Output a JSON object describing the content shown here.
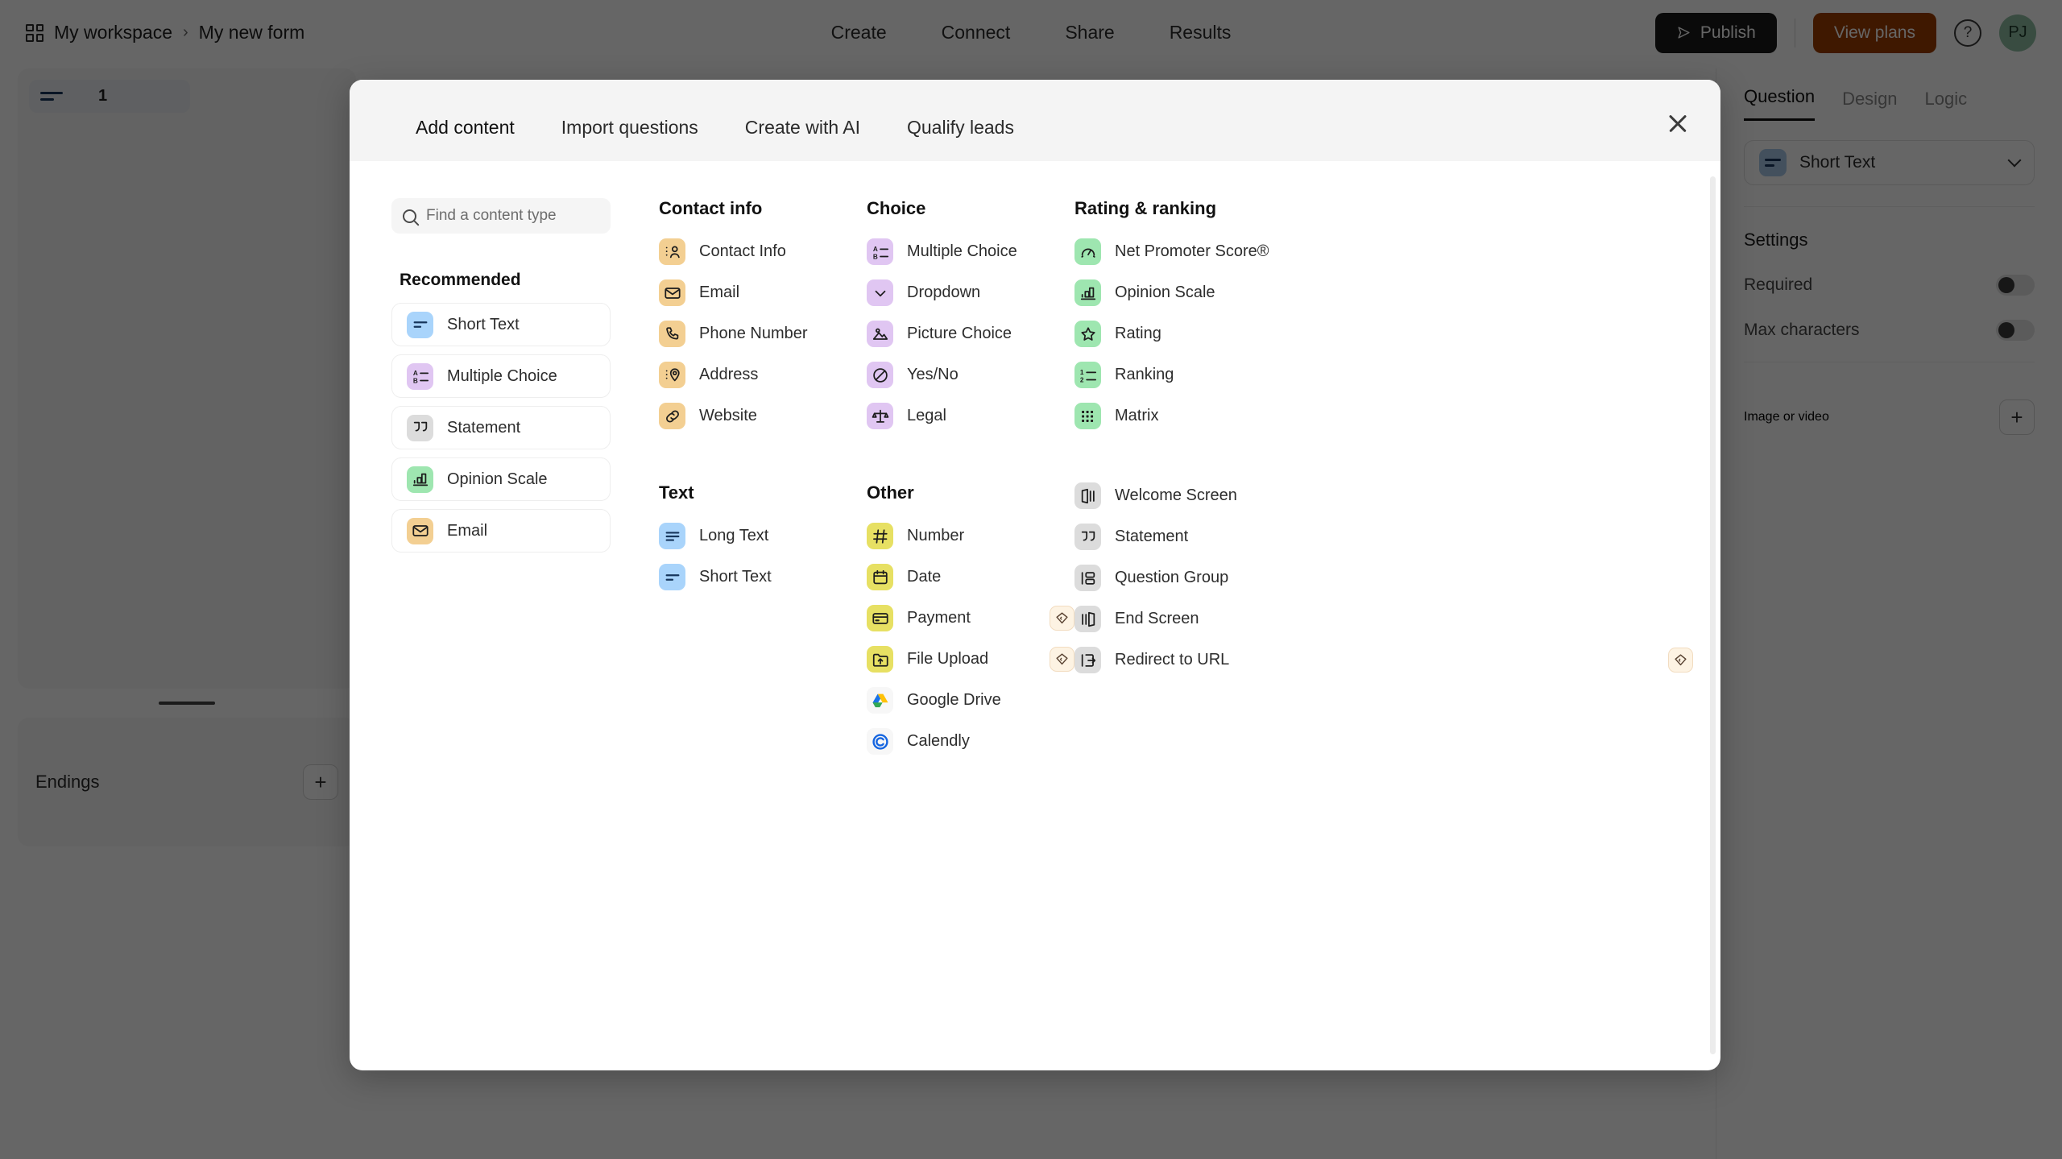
{
  "topbar": {
    "workspace": "My workspace",
    "separator": "›",
    "form_name": "My new form",
    "nav": [
      "Create",
      "Connect",
      "Share",
      "Results"
    ],
    "publish_label": "Publish",
    "view_plans_label": "View plans",
    "help_label": "?",
    "avatar_initials": "PJ"
  },
  "left_panel": {
    "question_number": "1",
    "endings_label": "Endings",
    "add_ending_label": "+"
  },
  "right_panel": {
    "tabs": [
      "Question",
      "Design",
      "Logic"
    ],
    "active_tab": "Question",
    "type_selector": "Short Text",
    "settings_heading": "Settings",
    "rows": [
      {
        "label": "Required",
        "value": "off"
      },
      {
        "label": "Max characters",
        "value": "off"
      }
    ],
    "image_or_video_label": "Image or video",
    "add_media_label": "+"
  },
  "modal": {
    "tabs": [
      {
        "label": "Add content",
        "active": true
      },
      {
        "label": "Import questions",
        "active": false
      },
      {
        "label": "Create with AI",
        "active": false
      },
      {
        "label": "Qualify leads",
        "active": false
      }
    ],
    "close_label": "×",
    "search": {
      "placeholder": "Find a content type",
      "value": ""
    },
    "recommended": {
      "title": "Recommended",
      "items": [
        {
          "label": "Short Text",
          "icon": "short-text-icon",
          "color": "blue"
        },
        {
          "label": "Multiple Choice",
          "icon": "multiple-choice-icon",
          "color": "purple"
        },
        {
          "label": "Statement",
          "icon": "statement-icon",
          "color": "gray"
        },
        {
          "label": "Opinion Scale",
          "icon": "opinion-scale-icon",
          "color": "green"
        },
        {
          "label": "Email",
          "icon": "email-icon",
          "color": "orange"
        }
      ]
    },
    "categories": [
      {
        "name": "Contact info",
        "column": 1,
        "items": [
          {
            "label": "Contact Info",
            "icon": "contact-info-icon",
            "color": "orange",
            "premium": false
          },
          {
            "label": "Email",
            "icon": "email-icon",
            "color": "orange",
            "premium": false
          },
          {
            "label": "Phone Number",
            "icon": "phone-icon",
            "color": "orange",
            "premium": false
          },
          {
            "label": "Address",
            "icon": "address-icon",
            "color": "orange",
            "premium": false
          },
          {
            "label": "Website",
            "icon": "website-link-icon",
            "color": "orange",
            "premium": false
          }
        ]
      },
      {
        "name": "Text",
        "column": 1,
        "items": [
          {
            "label": "Long Text",
            "icon": "long-text-icon",
            "color": "blue",
            "premium": false
          },
          {
            "label": "Short Text",
            "icon": "short-text-icon",
            "color": "blue",
            "premium": false
          }
        ]
      },
      {
        "name": "Choice",
        "column": 2,
        "items": [
          {
            "label": "Multiple Choice",
            "icon": "multiple-choice-icon",
            "color": "purple",
            "premium": false
          },
          {
            "label": "Dropdown",
            "icon": "chevron-down-icon",
            "color": "purple",
            "premium": false
          },
          {
            "label": "Picture Choice",
            "icon": "picture-choice-icon",
            "color": "purple",
            "premium": false
          },
          {
            "label": "Yes/No",
            "icon": "yes-no-icon",
            "color": "purple",
            "premium": false
          },
          {
            "label": "Legal",
            "icon": "legal-scales-icon",
            "color": "purple",
            "premium": false
          }
        ]
      },
      {
        "name": "Other",
        "column": 2,
        "items": [
          {
            "label": "Number",
            "icon": "hash-icon",
            "color": "yellow",
            "premium": false
          },
          {
            "label": "Date",
            "icon": "calendar-icon",
            "color": "yellow",
            "premium": false
          },
          {
            "label": "Payment",
            "icon": "credit-card-icon",
            "color": "yellow",
            "premium": true
          },
          {
            "label": "File Upload",
            "icon": "file-upload-icon",
            "color": "yellow",
            "premium": true
          },
          {
            "label": "Google Drive",
            "icon": "google-drive-icon",
            "color": "white",
            "premium": false
          },
          {
            "label": "Calendly",
            "icon": "calendly-icon",
            "color": "white",
            "premium": false
          }
        ]
      },
      {
        "name": "Rating & ranking",
        "column": 3,
        "items": [
          {
            "label": "Net Promoter Score®",
            "icon": "gauge-icon",
            "color": "green",
            "premium": false
          },
          {
            "label": "Opinion Scale",
            "icon": "opinion-scale-icon",
            "color": "green",
            "premium": false
          },
          {
            "label": "Rating",
            "icon": "star-icon",
            "color": "green",
            "premium": false
          },
          {
            "label": "Ranking",
            "icon": "ranking-icon",
            "color": "green",
            "premium": false
          },
          {
            "label": "Matrix",
            "icon": "matrix-icon",
            "color": "green",
            "premium": false
          }
        ]
      },
      {
        "name": "",
        "column": 3,
        "items": [
          {
            "label": "Welcome Screen",
            "icon": "welcome-screen-icon",
            "color": "gray",
            "premium": false
          },
          {
            "label": "Statement",
            "icon": "statement-icon",
            "color": "gray",
            "premium": false
          },
          {
            "label": "Question Group",
            "icon": "question-group-icon",
            "color": "gray",
            "premium": false
          },
          {
            "label": "End Screen",
            "icon": "end-screen-icon",
            "color": "gray",
            "premium": false
          },
          {
            "label": "Redirect to URL",
            "icon": "redirect-icon",
            "color": "gray",
            "premium": true
          }
        ]
      }
    ]
  },
  "colors": {
    "publish_bg": "#1b1b1b",
    "view_plans_bg": "#9e3d00",
    "avatar_bg": "#8fbfa4",
    "modal_header_bg": "#f4f4f4",
    "premium_badge_bg": "#fdf3e3"
  }
}
